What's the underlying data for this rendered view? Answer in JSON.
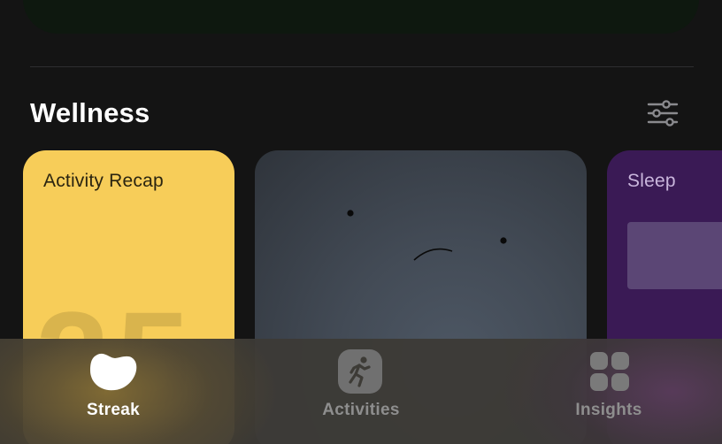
{
  "section": {
    "title": "Wellness"
  },
  "cards": {
    "activity": {
      "title": "Activity Recap",
      "big_number": "25"
    },
    "mood": {
      "title": ""
    },
    "sleep": {
      "title": "Sleep"
    }
  },
  "tabs": [
    {
      "label": "Streak",
      "icon": "streak-icon",
      "selected": true
    },
    {
      "label": "Activities",
      "icon": "running-person-icon",
      "selected": false
    },
    {
      "label": "Insights",
      "icon": "grid-icon",
      "selected": false
    }
  ],
  "colors": {
    "background": "#141414",
    "activity_card": "#f7cd59",
    "sleep_card": "#3a1a55",
    "tab_active": "#ffffff",
    "tab_inactive": "#8e8e8e"
  }
}
